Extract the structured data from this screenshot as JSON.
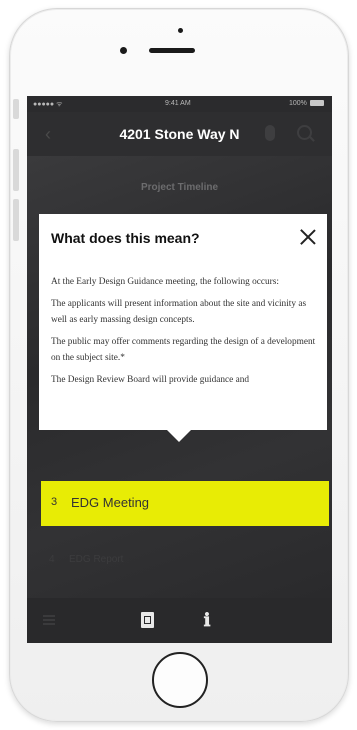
{
  "status_bar": {
    "carrier": "●●●●● ᯤ",
    "time": "9:41 AM",
    "battery": "100%"
  },
  "navbar": {
    "title": "4201 Stone Way N",
    "icons": [
      "back-arrow-icon",
      "microphone-icon",
      "search-icon"
    ]
  },
  "section": {
    "title": "Project Timeline"
  },
  "modal": {
    "title": "What does this mean?",
    "close_icon": "close-icon",
    "paragraphs": [
      "At the Early Design Guidance meeting, the following occurs:",
      "The applicants will present information about the site and vicinity as well as early massing design concepts.",
      "The public may offer comments regarding the design of a development on the subject site.*",
      "The Design Review Board will provide guidance and"
    ]
  },
  "timeline": {
    "active": {
      "number": "3",
      "label": "EDG Meeting",
      "color": "#e8ec05"
    },
    "next": {
      "number": "4",
      "label": "EDG Report"
    }
  },
  "tabbar": {
    "icons": [
      "menu-icon",
      "map-icon",
      "info-icon"
    ]
  }
}
